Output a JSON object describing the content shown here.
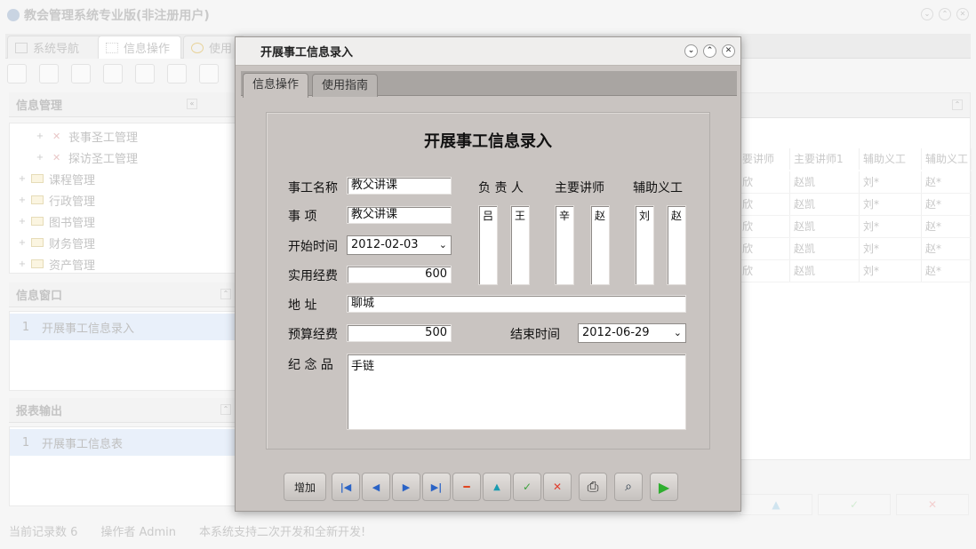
{
  "app": {
    "title": "教会管理系统专业版(非注册用户)",
    "tabs": [
      {
        "label": "系统导航"
      },
      {
        "label": "信息操作"
      },
      {
        "label": "使用"
      }
    ]
  },
  "left": {
    "info_mgmt": {
      "title": "信息管理",
      "items": [
        {
          "label": "丧事圣工管理",
          "kind": "leaf"
        },
        {
          "label": "探访圣工管理",
          "kind": "leaf"
        },
        {
          "label": "课程管理",
          "kind": "folder"
        },
        {
          "label": "行政管理",
          "kind": "folder"
        },
        {
          "label": "图书管理",
          "kind": "folder"
        },
        {
          "label": "财务管理",
          "kind": "folder"
        },
        {
          "label": "资产管理",
          "kind": "folder"
        }
      ]
    },
    "info_window": {
      "title": "信息窗口",
      "rows": [
        {
          "num": "1",
          "label": "开展事工信息录入"
        }
      ]
    },
    "report": {
      "title": "报表输出",
      "rows": [
        {
          "num": "1",
          "label": "开展事工信息表"
        }
      ]
    }
  },
  "grid": {
    "columns": [
      "要讲师",
      "主要讲师1",
      "辅助义工",
      "辅助义工"
    ],
    "rows": [
      [
        "欣",
        "赵凯",
        "刘*",
        "赵*"
      ],
      [
        "欣",
        "赵凯",
        "刘*",
        "赵*"
      ],
      [
        "欣",
        "赵凯",
        "刘*",
        "赵*"
      ],
      [
        "欣",
        "赵凯",
        "刘*",
        "赵*"
      ],
      [
        "欣",
        "赵凯",
        "刘*",
        "赵*"
      ]
    ]
  },
  "status": {
    "records": "当前记录数 6",
    "operator": "操作者 Admin",
    "note": "本系统支持二次开发和全新开发!"
  },
  "dialog": {
    "title": "开展事工信息录入",
    "tabs": [
      {
        "label": "信息操作"
      },
      {
        "label": "使用指南"
      }
    ],
    "form_title": "开展事工信息录入",
    "labels": {
      "name": "事工名称",
      "item": "事 项",
      "start": "开始时间",
      "cost": "实用经费",
      "address": "地 址",
      "budget": "预算经费",
      "end": "结束时间",
      "souvenir": "纪 念 品",
      "leader": "负 责 人",
      "lecturer": "主要讲师",
      "volunteer": "辅助义工"
    },
    "values": {
      "name": "教父讲课",
      "item": "教父讲课",
      "start": "2012-02-03",
      "cost": "600",
      "address": "聊城",
      "budget": "500",
      "end": "2012-06-29",
      "souvenir": "手链",
      "leader1": "吕",
      "leader2": "王",
      "lecturer1": "辛",
      "lecturer2": "赵",
      "volunteer1": "刘",
      "volunteer2": "赵"
    },
    "buttons": {
      "add": "增加"
    }
  }
}
